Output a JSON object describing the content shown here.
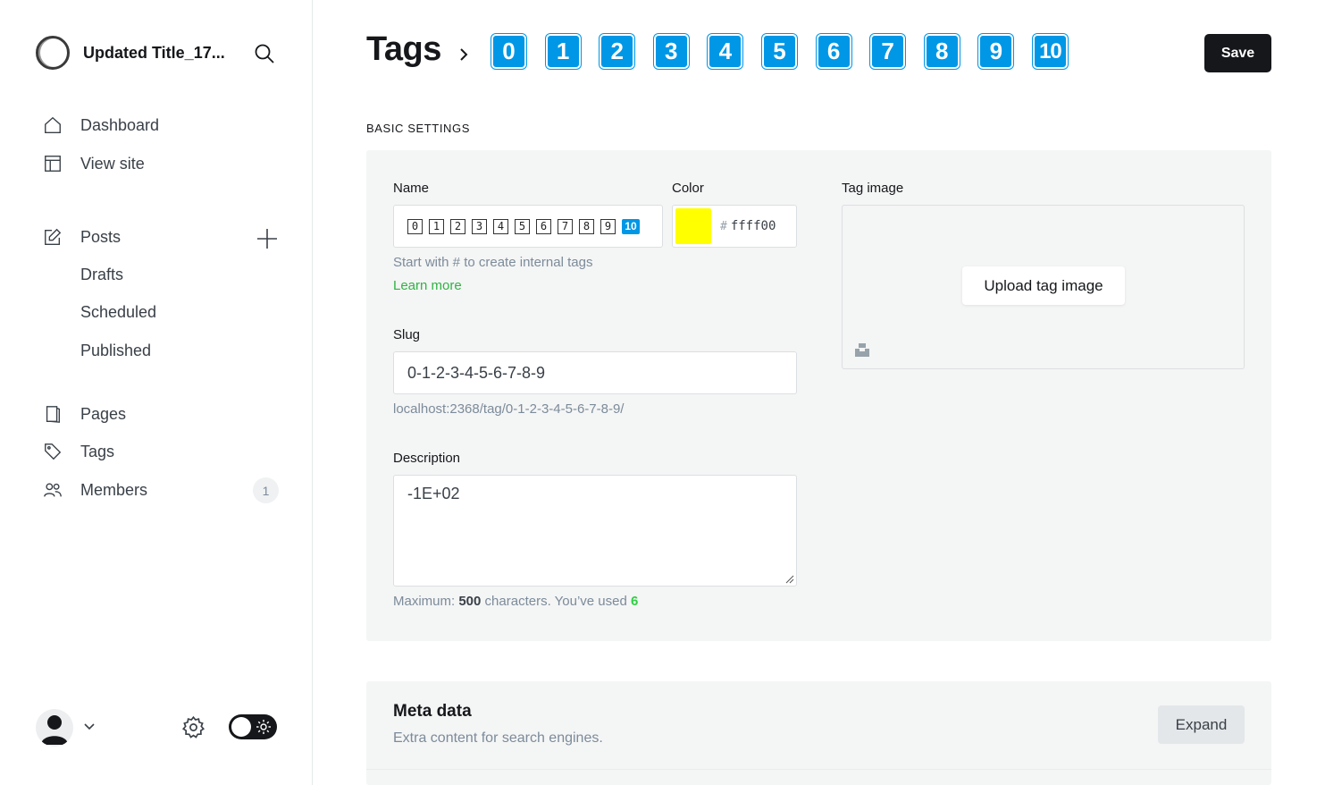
{
  "sidebar": {
    "site_title": "Updated Title_17...",
    "nav": {
      "dashboard": "Dashboard",
      "view_site": "View site",
      "posts": "Posts",
      "drafts": "Drafts",
      "scheduled": "Scheduled",
      "published": "Published",
      "pages": "Pages",
      "tags": "Tags",
      "members": "Members",
      "members_count": "1"
    }
  },
  "header": {
    "title": "Tags",
    "breadcrumb_tiles": [
      "0",
      "1",
      "2",
      "3",
      "4",
      "5",
      "6",
      "7",
      "8",
      "9",
      "10"
    ],
    "save_label": "Save"
  },
  "basic": {
    "section_label": "BASIC SETTINGS",
    "name_label": "Name",
    "name_glyphs": [
      "0",
      "1",
      "2",
      "3",
      "4",
      "5",
      "6",
      "7",
      "8",
      "9",
      "10"
    ],
    "color_label": "Color",
    "color_hash": "#",
    "color_value": "ffff00",
    "color_swatch": "#ffff00",
    "name_hint": "Start with # to create internal tags",
    "learn_more": "Learn more",
    "slug_label": "Slug",
    "slug_value": "0-1-2-3-4-5-6-7-8-9",
    "slug_url": "localhost:2368/tag/0-1-2-3-4-5-6-7-8-9/",
    "description_label": "Description",
    "description_value": "-1E+02",
    "counter_prefix": "Maximum: ",
    "counter_max": "500",
    "counter_mid": " characters. You’ve used ",
    "counter_used": "6",
    "tag_image_label": "Tag image",
    "upload_label": "Upload tag image"
  },
  "meta": {
    "title": "Meta data",
    "subtitle": "Extra content for search engines.",
    "expand_label": "Expand"
  },
  "colors": {
    "accent_blue": "#0097e6",
    "primary_dark": "#15171a",
    "green": "#30cf43"
  }
}
